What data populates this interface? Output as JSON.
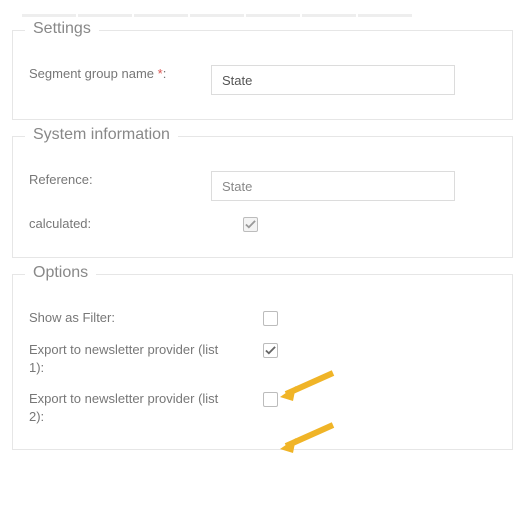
{
  "settings": {
    "legend": "Settings",
    "segment_group_name_label": "Segment group name",
    "segment_group_name_value": "State"
  },
  "system_info": {
    "legend": "System information",
    "reference_label": "Reference:",
    "reference_value": "State",
    "calculated_label": "calculated:",
    "calculated_checked": true
  },
  "options": {
    "legend": "Options",
    "show_as_filter_label": "Show as Filter:",
    "show_as_filter_checked": false,
    "export_list1_label": "Export to newsletter provider (list 1):",
    "export_list1_checked": true,
    "export_list2_label": "Export to newsletter provider (list 2):",
    "export_list2_checked": false
  }
}
